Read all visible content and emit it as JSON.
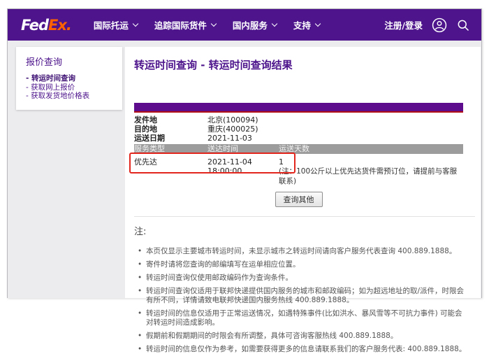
{
  "nav": {
    "logo": {
      "fed": "Fed",
      "ex": "Ex",
      "dot": "."
    },
    "items": [
      {
        "label": "国际托运"
      },
      {
        "label": "追踪国际货件"
      },
      {
        "label": "国内服务"
      },
      {
        "label": "支持"
      }
    ],
    "register_label": "注册/登录"
  },
  "sidebar": {
    "title": "报价查询",
    "items": [
      {
        "label": "转运时间查询"
      },
      {
        "label": "获取网上报价"
      },
      {
        "label": "获取发货地价格表"
      }
    ]
  },
  "main": {
    "title": "转运时间查询 - 转运时间查询结果",
    "query": {
      "fields": [
        {
          "label": "发件地",
          "value": "北京(100094)"
        },
        {
          "label": "目的地",
          "value": "重庆(400025)"
        },
        {
          "label": "运送日期",
          "value": "2021-11-03"
        }
      ],
      "columns": [
        "服务类型",
        "送达时间",
        "运送天数"
      ],
      "result": {
        "service": "优先达",
        "delivery_time": "2021-11-04 18:00:00",
        "days": "1",
        "note": "(注：100公斤以上优先达货件需预订位，请提前与客服联系)"
      }
    },
    "query_other_label": "查询其他",
    "notes": {
      "heading": "注:",
      "items": [
        "本页仅显示主要城市转运时间，未显示城市之转运时间请向客户服务代表查询 400.889.1888。",
        "寄件时请将您查询的邮编填写在运单相应位置。",
        "转运时间查询仅使用邮政编码作为查询条件。",
        "转运时间查询仅适用于联邦快递提供国内服务的城市和邮政编码；如为超远地址的取/派件，时限会有所不同，详情请致电联邦快递国内服务热线 400.889.1888。",
        "转运时间的信息仅适用于正常运送情况，如遇特殊事件(比如洪水、暴风雪等不可抗力事件) 可能会对转运时间造成影响。",
        "假期前和假期期间的时限会有所调整，具体可咨询客服热线 400.889.1888。",
        "转运时间的信息仅作为参考，如需要获得更多的信息请联系我们的客户服务代表: 400.889.1888。"
      ]
    }
  },
  "colors": {
    "brand_purple": "#4D148C",
    "brand_orange": "#FF6200",
    "table_bar_purple": "#5E0C8E",
    "table_bar_red": "#B11016",
    "header_gray": "#9C9C9C",
    "annotation_red": "#E3261D"
  }
}
